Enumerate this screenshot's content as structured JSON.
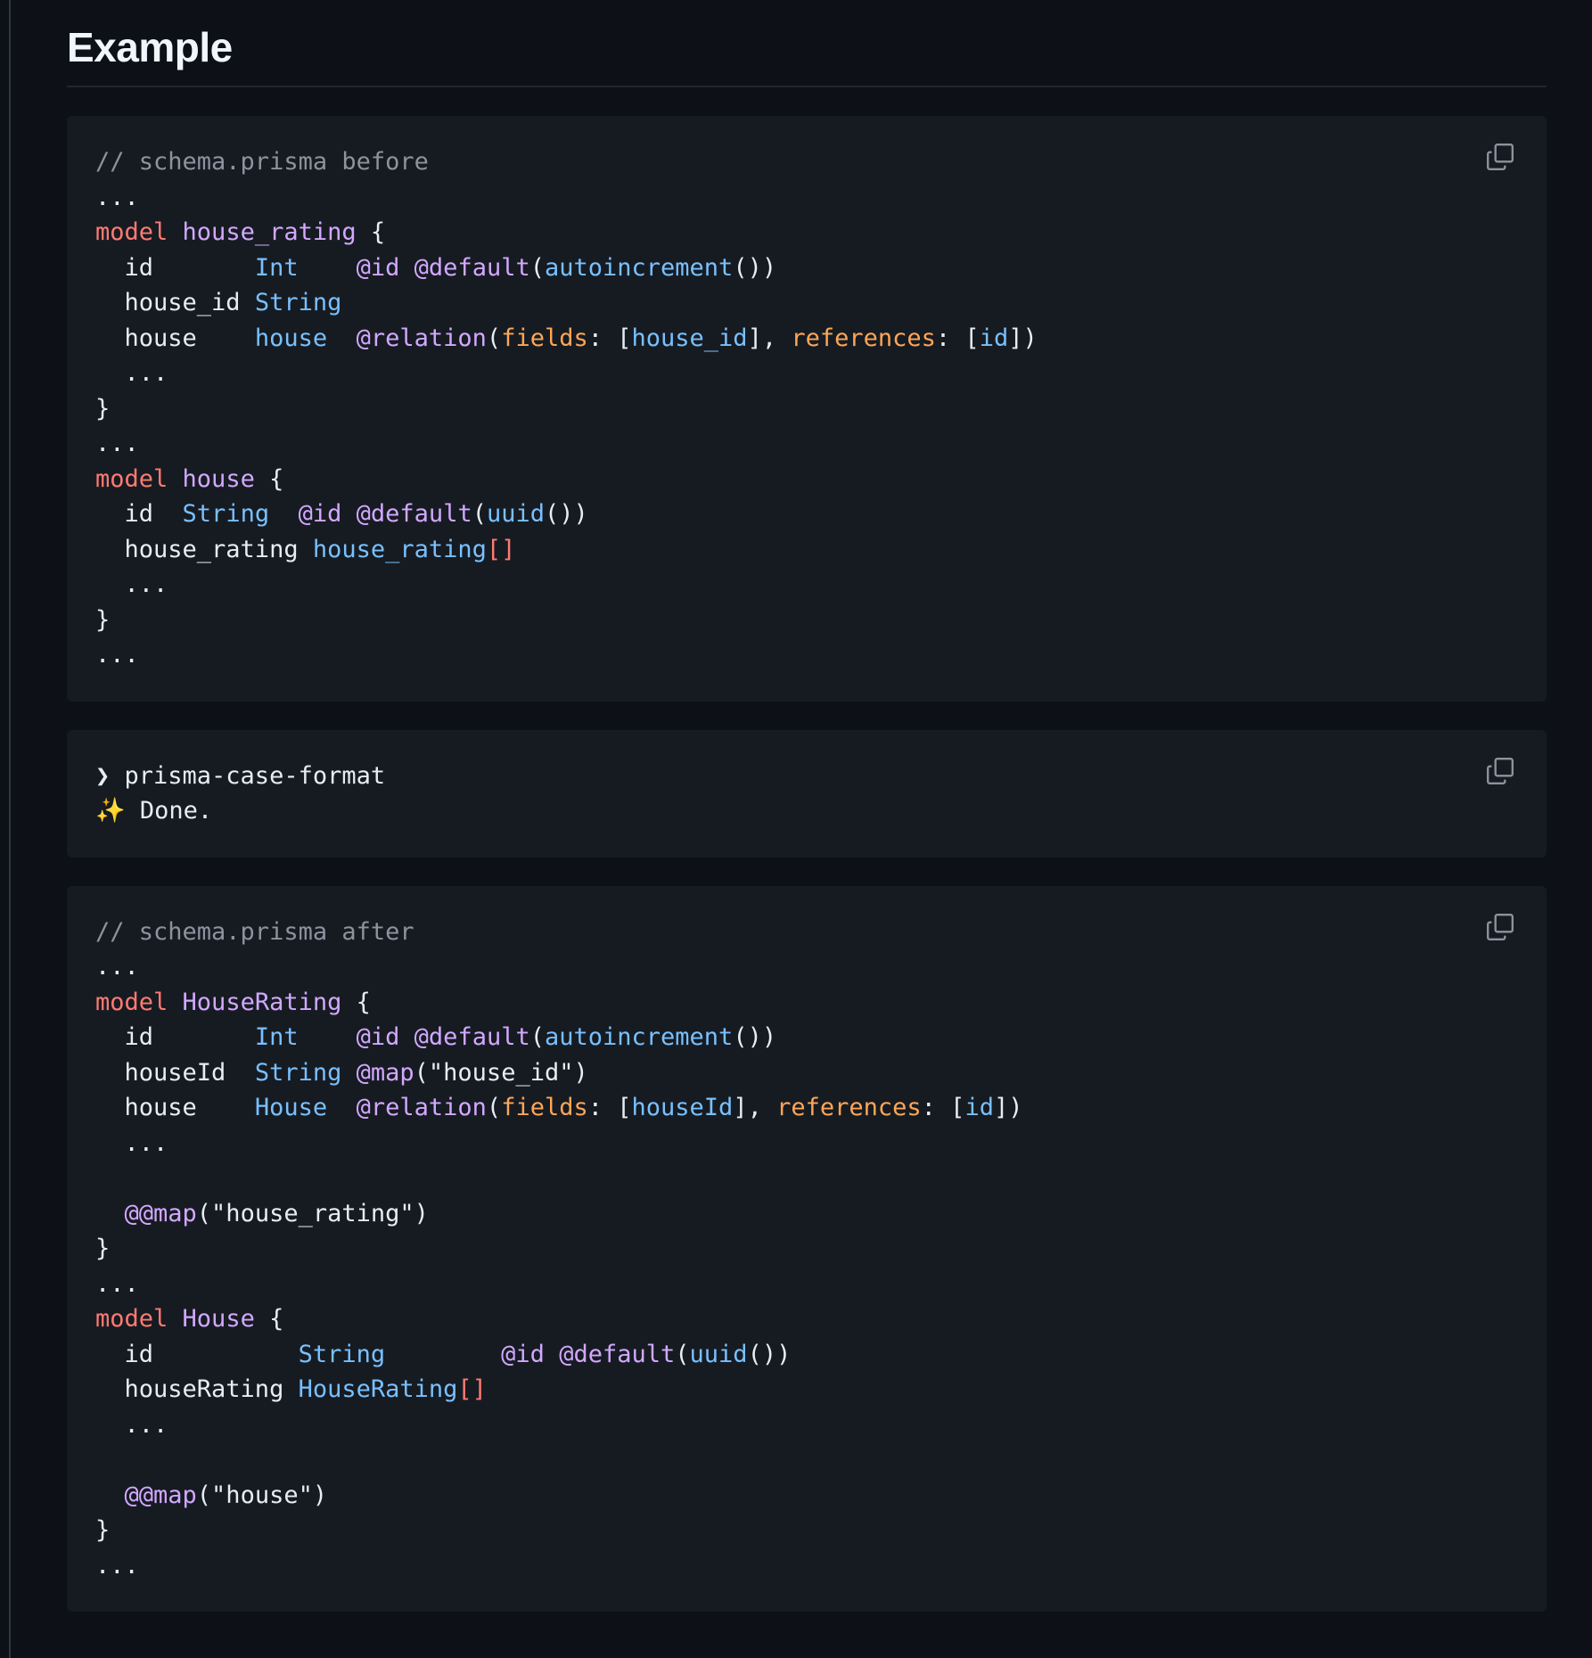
{
  "heading": "Example",
  "code_blocks": [
    {
      "id": "before",
      "lines": [
        [
          {
            "t": "// schema.prisma before",
            "k": "comment"
          }
        ],
        [
          {
            "t": "...",
            "k": "plain"
          }
        ],
        [
          {
            "t": "model",
            "k": "kw"
          },
          {
            "t": " ",
            "k": "plain"
          },
          {
            "t": "house_rating",
            "k": "name"
          },
          {
            "t": " {",
            "k": "plain"
          }
        ],
        [
          {
            "t": "  id       ",
            "k": "plain"
          },
          {
            "t": "Int",
            "k": "type"
          },
          {
            "t": "    ",
            "k": "plain"
          },
          {
            "t": "@id",
            "k": "attr"
          },
          {
            "t": " ",
            "k": "plain"
          },
          {
            "t": "@default",
            "k": "attr"
          },
          {
            "t": "(",
            "k": "plain"
          },
          {
            "t": "autoincrement",
            "k": "fn"
          },
          {
            "t": "())",
            "k": "plain"
          }
        ],
        [
          {
            "t": "  house_id ",
            "k": "plain"
          },
          {
            "t": "String",
            "k": "type"
          }
        ],
        [
          {
            "t": "  house    ",
            "k": "plain"
          },
          {
            "t": "house",
            "k": "type"
          },
          {
            "t": "  ",
            "k": "plain"
          },
          {
            "t": "@relation",
            "k": "attr"
          },
          {
            "t": "(",
            "k": "plain"
          },
          {
            "t": "fields",
            "k": "arg"
          },
          {
            "t": ": [",
            "k": "plain"
          },
          {
            "t": "house_id",
            "k": "ref"
          },
          {
            "t": "], ",
            "k": "plain"
          },
          {
            "t": "references",
            "k": "arg"
          },
          {
            "t": ": [",
            "k": "plain"
          },
          {
            "t": "id",
            "k": "ref"
          },
          {
            "t": "])",
            "k": "plain"
          }
        ],
        [
          {
            "t": "  ...",
            "k": "plain"
          }
        ],
        [
          {
            "t": "}",
            "k": "plain"
          }
        ],
        [
          {
            "t": "...",
            "k": "plain"
          }
        ],
        [
          {
            "t": "model",
            "k": "kw"
          },
          {
            "t": " ",
            "k": "plain"
          },
          {
            "t": "house",
            "k": "name"
          },
          {
            "t": " {",
            "k": "plain"
          }
        ],
        [
          {
            "t": "  id  ",
            "k": "plain"
          },
          {
            "t": "String",
            "k": "type"
          },
          {
            "t": "  ",
            "k": "plain"
          },
          {
            "t": "@id",
            "k": "attr"
          },
          {
            "t": " ",
            "k": "plain"
          },
          {
            "t": "@default",
            "k": "attr"
          },
          {
            "t": "(",
            "k": "plain"
          },
          {
            "t": "uuid",
            "k": "fn"
          },
          {
            "t": "())",
            "k": "plain"
          }
        ],
        [
          {
            "t": "  house_rating ",
            "k": "plain"
          },
          {
            "t": "house_rating",
            "k": "type"
          },
          {
            "t": "[]",
            "k": "bracket"
          }
        ],
        [
          {
            "t": "  ...",
            "k": "plain"
          }
        ],
        [
          {
            "t": "}",
            "k": "plain"
          }
        ],
        [
          {
            "t": "...",
            "k": "plain"
          }
        ]
      ]
    },
    {
      "id": "command",
      "lines": [
        [
          {
            "t": "❯ prisma-case-format",
            "k": "plain"
          }
        ],
        [
          {
            "t": "✨ Done.",
            "k": "plain"
          }
        ]
      ]
    },
    {
      "id": "after",
      "lines": [
        [
          {
            "t": "// schema.prisma after",
            "k": "comment"
          }
        ],
        [
          {
            "t": "...",
            "k": "plain"
          }
        ],
        [
          {
            "t": "model",
            "k": "kw"
          },
          {
            "t": " ",
            "k": "plain"
          },
          {
            "t": "HouseRating",
            "k": "name"
          },
          {
            "t": " {",
            "k": "plain"
          }
        ],
        [
          {
            "t": "  id       ",
            "k": "plain"
          },
          {
            "t": "Int",
            "k": "type"
          },
          {
            "t": "    ",
            "k": "plain"
          },
          {
            "t": "@id",
            "k": "attr"
          },
          {
            "t": " ",
            "k": "plain"
          },
          {
            "t": "@default",
            "k": "attr"
          },
          {
            "t": "(",
            "k": "plain"
          },
          {
            "t": "autoincrement",
            "k": "fn"
          },
          {
            "t": "())",
            "k": "plain"
          }
        ],
        [
          {
            "t": "  houseId  ",
            "k": "plain"
          },
          {
            "t": "String",
            "k": "type"
          },
          {
            "t": " ",
            "k": "plain"
          },
          {
            "t": "@map",
            "k": "attr"
          },
          {
            "t": "(\"house_id\")",
            "k": "str"
          }
        ],
        [
          {
            "t": "  house    ",
            "k": "plain"
          },
          {
            "t": "House",
            "k": "type"
          },
          {
            "t": "  ",
            "k": "plain"
          },
          {
            "t": "@relation",
            "k": "attr"
          },
          {
            "t": "(",
            "k": "plain"
          },
          {
            "t": "fields",
            "k": "arg"
          },
          {
            "t": ": [",
            "k": "plain"
          },
          {
            "t": "houseId",
            "k": "ref"
          },
          {
            "t": "], ",
            "k": "plain"
          },
          {
            "t": "references",
            "k": "arg"
          },
          {
            "t": ": [",
            "k": "plain"
          },
          {
            "t": "id",
            "k": "ref"
          },
          {
            "t": "])",
            "k": "plain"
          }
        ],
        [
          {
            "t": "  ...",
            "k": "plain"
          }
        ],
        [
          {
            "t": "",
            "k": "plain"
          }
        ],
        [
          {
            "t": "  ",
            "k": "plain"
          },
          {
            "t": "@@map",
            "k": "attr"
          },
          {
            "t": "(\"house_rating\")",
            "k": "str"
          }
        ],
        [
          {
            "t": "}",
            "k": "plain"
          }
        ],
        [
          {
            "t": "...",
            "k": "plain"
          }
        ],
        [
          {
            "t": "model",
            "k": "kw"
          },
          {
            "t": " ",
            "k": "plain"
          },
          {
            "t": "House",
            "k": "name"
          },
          {
            "t": " {",
            "k": "plain"
          }
        ],
        [
          {
            "t": "  id          ",
            "k": "plain"
          },
          {
            "t": "String",
            "k": "type"
          },
          {
            "t": "        ",
            "k": "plain"
          },
          {
            "t": "@id",
            "k": "attr"
          },
          {
            "t": " ",
            "k": "plain"
          },
          {
            "t": "@default",
            "k": "attr"
          },
          {
            "t": "(",
            "k": "plain"
          },
          {
            "t": "uuid",
            "k": "fn"
          },
          {
            "t": "())",
            "k": "plain"
          }
        ],
        [
          {
            "t": "  houseRating ",
            "k": "plain"
          },
          {
            "t": "HouseRating",
            "k": "type"
          },
          {
            "t": "[]",
            "k": "bracket"
          }
        ],
        [
          {
            "t": "  ...",
            "k": "plain"
          }
        ],
        [
          {
            "t": "",
            "k": "plain"
          }
        ],
        [
          {
            "t": "  ",
            "k": "plain"
          },
          {
            "t": "@@map",
            "k": "attr"
          },
          {
            "t": "(\"house\")",
            "k": "str"
          }
        ],
        [
          {
            "t": "}",
            "k": "plain"
          }
        ],
        [
          {
            "t": "...",
            "k": "plain"
          }
        ]
      ]
    }
  ],
  "icons": {
    "copy": "copy-icon"
  },
  "colors": {
    "background": "#0d1117",
    "code_background": "#161b22",
    "keyword": "#ff7b72",
    "entity": "#d2a8ff",
    "type": "#79c0ff",
    "argument": "#ffa657",
    "comment": "#8b949e"
  }
}
